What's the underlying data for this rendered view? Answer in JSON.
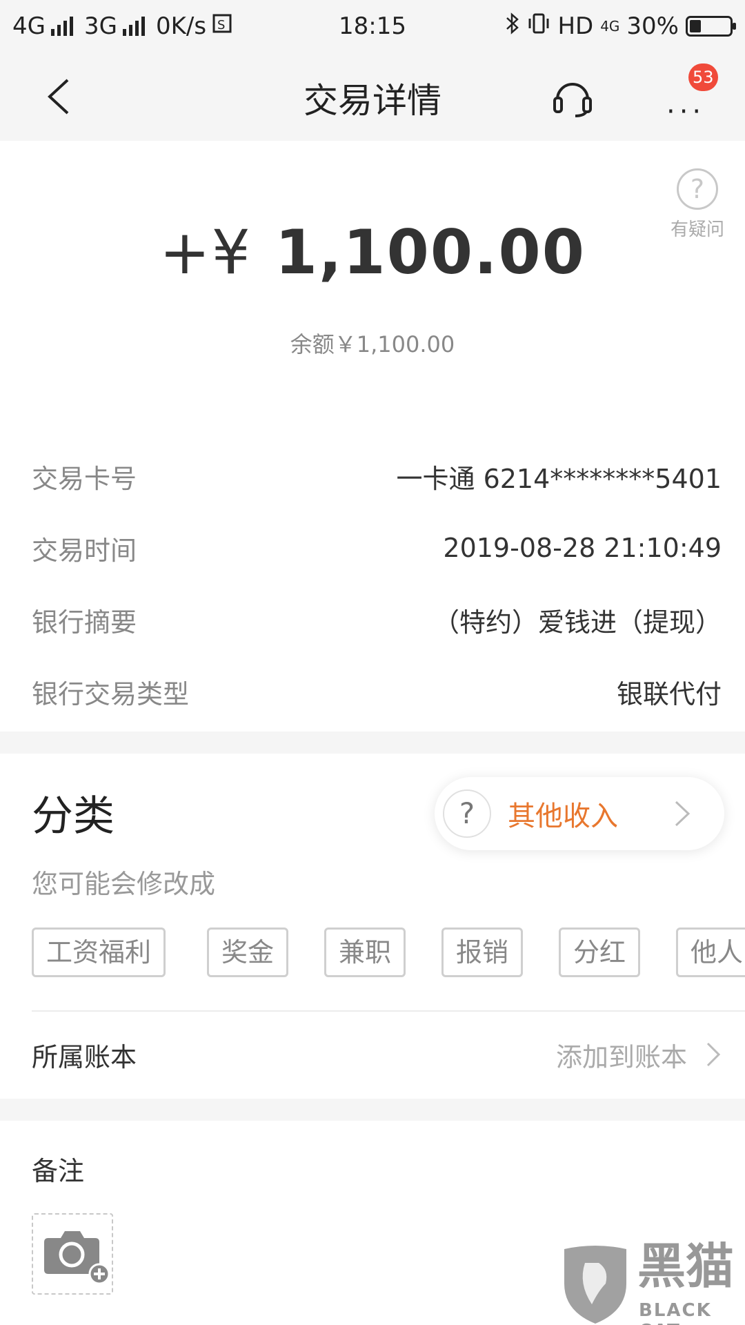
{
  "status_bar": {
    "network1": "4G",
    "network2": "3G",
    "speed": "0K/s",
    "time": "18:15",
    "hd": "HD",
    "net4g": "4G",
    "battery": "30%"
  },
  "nav": {
    "title": "交易详情",
    "badge": "53",
    "more": "···"
  },
  "help": {
    "label": "有疑问",
    "symbol": "?"
  },
  "amount": {
    "sign": "+¥",
    "value": "1,100.00",
    "balance": "余额￥1,100.00"
  },
  "details": [
    {
      "key": "交易卡号",
      "value": "一卡通 6214********5401"
    },
    {
      "key": "交易时间",
      "value": "2019-08-28 21:10:49"
    },
    {
      "key": "银行摘要",
      "value": "（特约）爱钱进（提现）"
    },
    {
      "key": "银行交易类型",
      "value": "银联代付"
    }
  ],
  "category": {
    "title": "分类",
    "current": "其他收入",
    "symbol": "?",
    "suggest_label": "您可能会修改成",
    "tags": [
      "工资福利",
      "奖金",
      "兼职",
      "报销",
      "分红",
      "他人"
    ]
  },
  "account_book": {
    "label": "所属账本",
    "action": "添加到账本"
  },
  "notes": {
    "title": "备注"
  },
  "watermark": {
    "cn": "黑猫",
    "en": "BLACK CAT"
  },
  "colors": {
    "accent": "#e8772e",
    "badge": "#f04a3a"
  }
}
